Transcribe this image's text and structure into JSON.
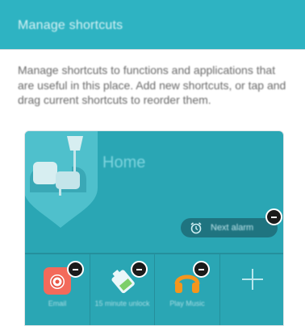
{
  "header": {
    "title": "Manage shortcuts"
  },
  "description": "Manage shortcuts to functions and applications that are useful in this place. Add new shortcuts, or tap and drag current shortcuts to reorder them.",
  "place": {
    "name": "Home"
  },
  "alarm": {
    "label": "Next alarm"
  },
  "shortcuts": [
    {
      "label": "Email",
      "icon": "email-icon"
    },
    {
      "label": "15 minute unlock",
      "icon": "battery-icon"
    },
    {
      "label": "Play Music",
      "icon": "headphones-icon"
    }
  ],
  "colors": {
    "header": "#2eb3c2",
    "card": "#2aa6b4",
    "remove_badge": "#1b1b1b"
  }
}
